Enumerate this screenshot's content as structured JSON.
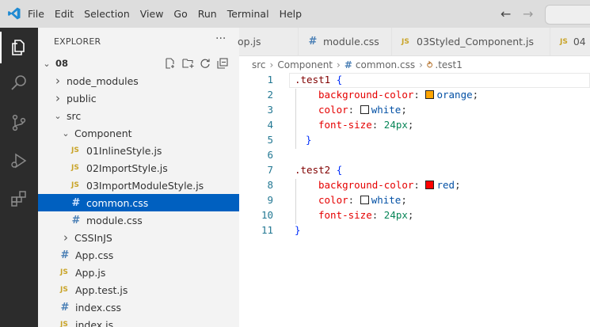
{
  "menu": [
    "File",
    "Edit",
    "Selection",
    "View",
    "Go",
    "Run",
    "Terminal",
    "Help"
  ],
  "explorer": {
    "title": "EXPLORER",
    "more": "···",
    "root": "08",
    "items": [
      {
        "label": "node_modules",
        "kind": "folder",
        "open": false,
        "depth": 1
      },
      {
        "label": "public",
        "kind": "folder",
        "open": false,
        "depth": 1
      },
      {
        "label": "src",
        "kind": "folder",
        "open": true,
        "depth": 1
      },
      {
        "label": "Component",
        "kind": "folder",
        "open": true,
        "depth": 2
      },
      {
        "label": "01InlineStyle.js",
        "kind": "js",
        "depth": 3
      },
      {
        "label": "02ImportStyle.js",
        "kind": "js",
        "depth": 3
      },
      {
        "label": "03ImportModuleStyle.js",
        "kind": "js",
        "depth": 3
      },
      {
        "label": "common.css",
        "kind": "css",
        "depth": 3,
        "selected": true
      },
      {
        "label": "module.css",
        "kind": "css",
        "depth": 3
      },
      {
        "label": "CSSInJS",
        "kind": "folder",
        "open": false,
        "depth": 2
      },
      {
        "label": "App.css",
        "kind": "css",
        "depth": 2
      },
      {
        "label": "App.js",
        "kind": "js",
        "depth": 2
      },
      {
        "label": "App.test.js",
        "kind": "js",
        "depth": 2
      },
      {
        "label": "index.css",
        "kind": "css",
        "depth": 2
      },
      {
        "label": "index.js",
        "kind": "js",
        "depth": 2
      }
    ]
  },
  "tabs": [
    {
      "label": "op.js",
      "kind": "none"
    },
    {
      "label": "module.css",
      "kind": "css"
    },
    {
      "label": "03Styled_Component.js",
      "kind": "js"
    },
    {
      "label": "04",
      "kind": "js"
    }
  ],
  "breadcrumb": [
    "src",
    "Component",
    "common.css",
    ".test1"
  ],
  "code": {
    "line_numbers": [
      "1",
      "2",
      "3",
      "4",
      "5",
      "6",
      "7",
      "8",
      "9",
      "10",
      "11"
    ],
    "test1_selector": ".test1",
    "test2_selector": ".test2",
    "open_brace": "{",
    "close_brace": "}",
    "bg_prop": "background-color",
    "color_prop": "color",
    "fs_prop": "font-size",
    "orange": "orange",
    "white": "white",
    "red": "red",
    "size": "24px",
    "colon": ":",
    "semicolon": ";",
    "orange_hex": "#ffa500",
    "red_hex": "#ff0000",
    "white_hex": "#ffffff"
  },
  "colors": {
    "accent": "#0060c0",
    "activity_bar": "#2c2c2c"
  }
}
